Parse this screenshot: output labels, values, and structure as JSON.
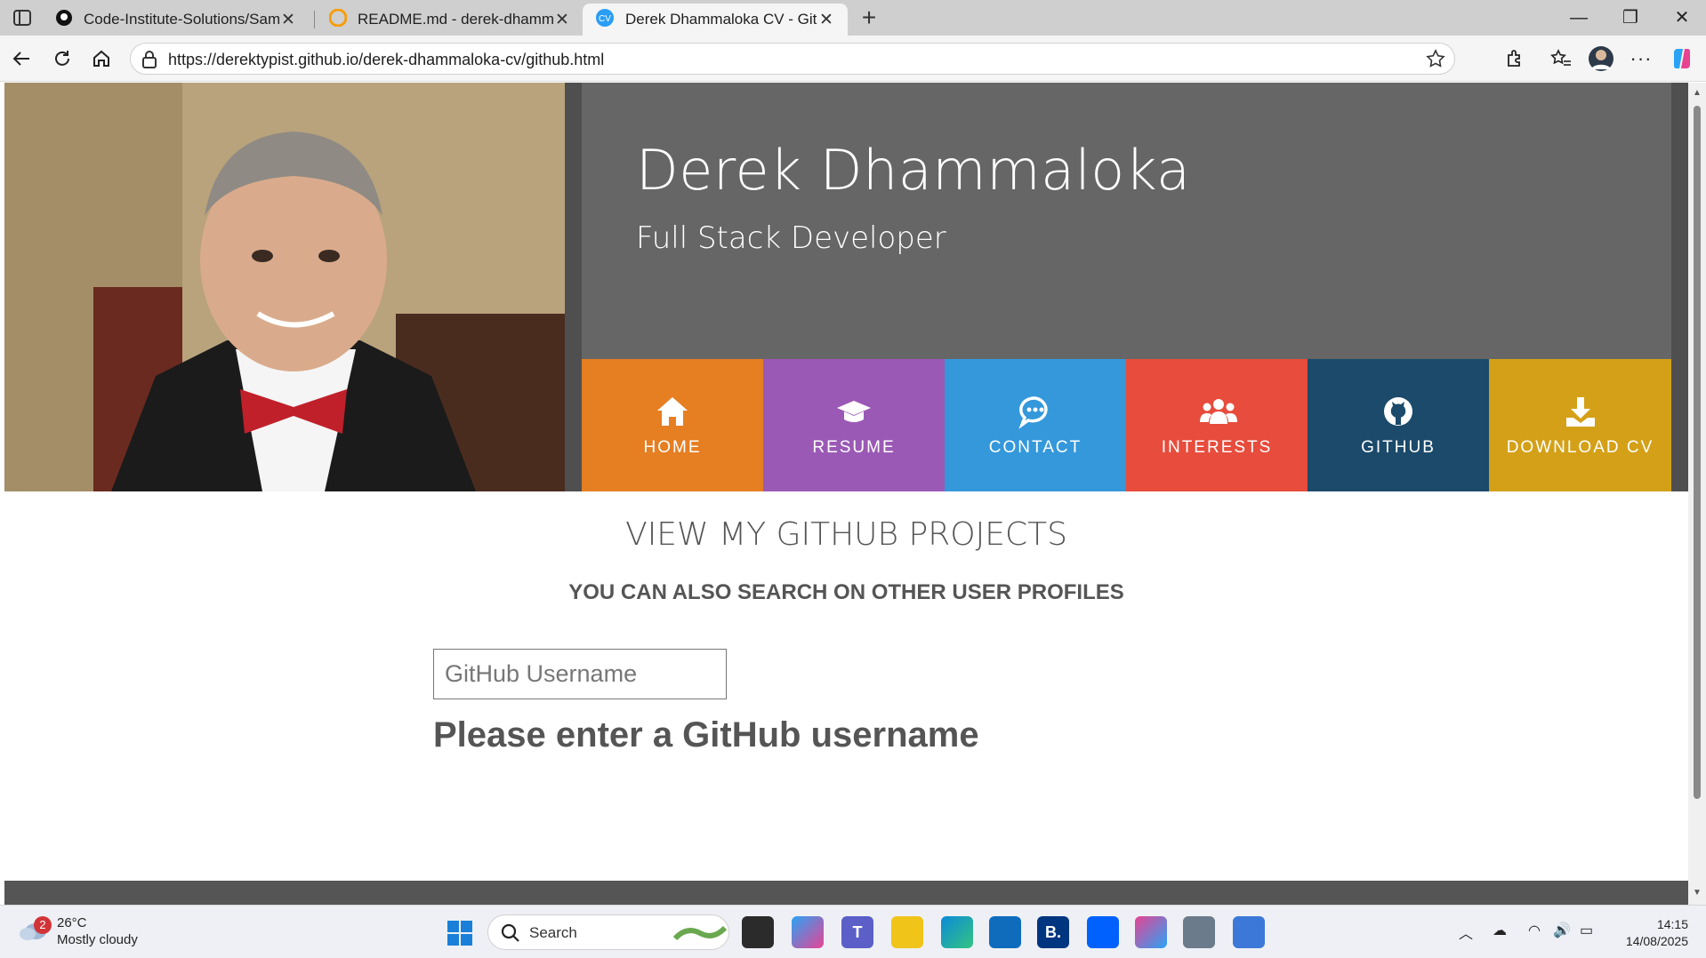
{
  "browser": {
    "tabs": [
      {
        "title": "Code-Institute-Solutions/SampleF",
        "icon": "github-icon",
        "active": false
      },
      {
        "title": "README.md - derek-dhammaloka",
        "icon": "gitpod-icon",
        "active": false
      },
      {
        "title": "Derek Dhammaloka CV - GitHub",
        "icon": "cv-favicon",
        "favicon_text": "CV",
        "active": true
      }
    ],
    "url": "https://derektypist.github.io/derek-dhammaloka-cv/github.html"
  },
  "hero": {
    "name": "Derek Dhammaloka",
    "role": "Full Stack Developer"
  },
  "nav": [
    {
      "label": "HOME",
      "icon": "home-icon",
      "color": "#e67e22"
    },
    {
      "label": "RESUME",
      "icon": "graduation-cap-icon",
      "color": "#9b59b6"
    },
    {
      "label": "CONTACT",
      "icon": "chat-icon",
      "color": "#3498db"
    },
    {
      "label": "INTERESTS",
      "icon": "users-icon",
      "color": "#e74c3c"
    },
    {
      "label": "GITHUB",
      "icon": "github-icon",
      "color": "#1b4a6b"
    },
    {
      "label": "DOWNLOAD CV",
      "icon": "download-icon",
      "color": "#d4a017"
    }
  ],
  "github_section": {
    "title": "VIEW MY GITHUB PROJECTS",
    "subtitle": "YOU CAN ALSO SEARCH ON OTHER USER PROFILES",
    "input_placeholder": "GitHub Username",
    "message": "Please enter a GitHub username"
  },
  "taskbar": {
    "weather_temp": "26°C",
    "weather_desc": "Mostly cloudy",
    "weather_badge": "2",
    "search_label": "Search",
    "time": "14:15",
    "date": "14/08/2025"
  }
}
